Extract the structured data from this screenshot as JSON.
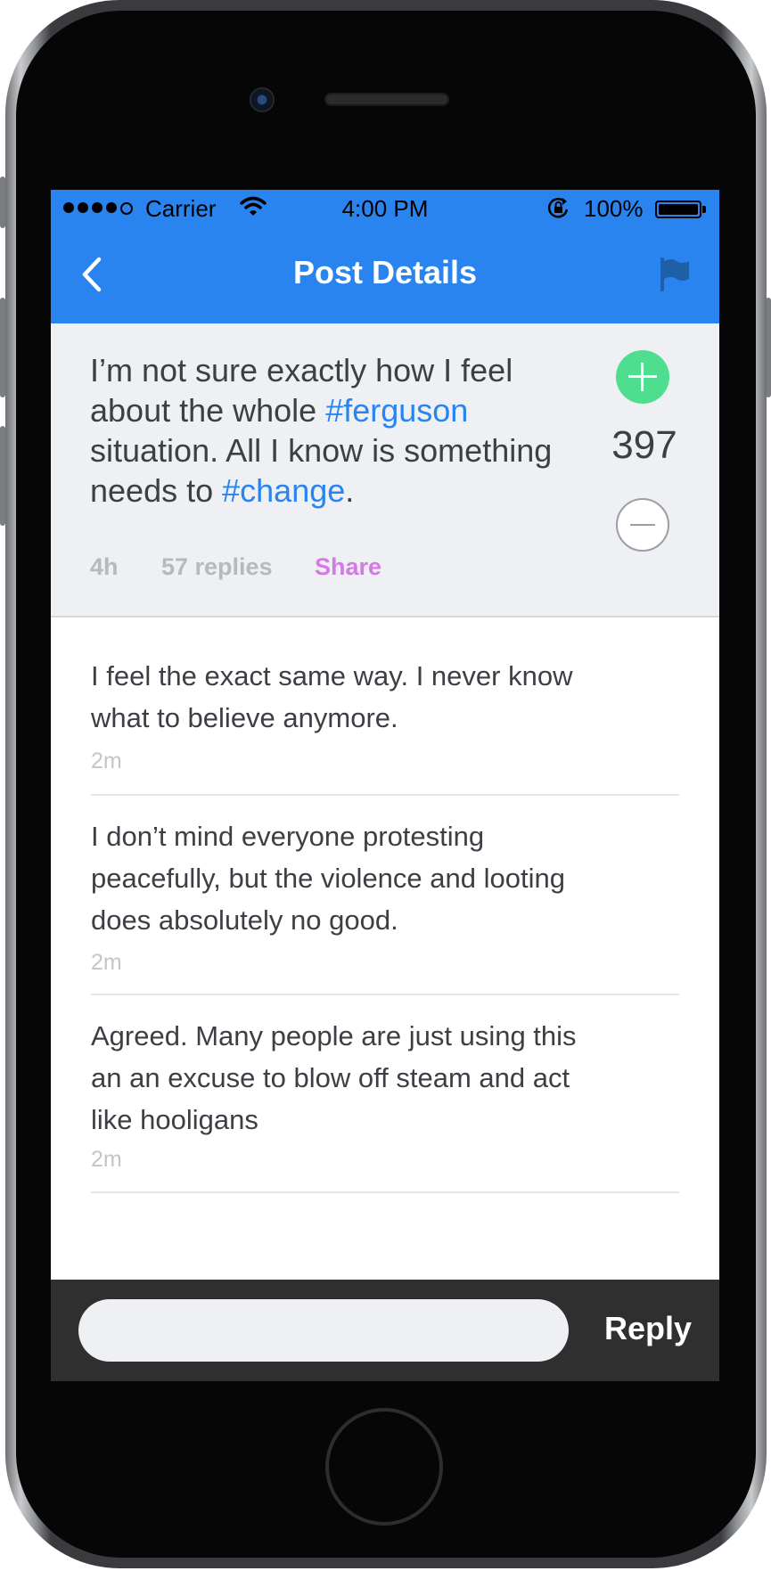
{
  "status_bar": {
    "carrier": "Carrier",
    "time": "4:00 PM",
    "battery_percent": "100%",
    "signal_bars_filled": 4,
    "signal_bars_total": 5,
    "icons": [
      "wifi-icon",
      "rotation-lock-icon",
      "battery-icon"
    ]
  },
  "nav": {
    "title": "Post Details",
    "back_icon": "chevron-left-icon",
    "report_icon": "flag-icon"
  },
  "post": {
    "text_1": "I’m not sure exactly how I feel about the whole ",
    "tag_1": "#ferguson",
    "text_2": " situation. All I know is something needs to ",
    "tag_2": "#change",
    "text_3": ".",
    "age": "4h",
    "replies": "57 replies",
    "share": "Share",
    "score": "397"
  },
  "replies": [
    {
      "text": "I feel the exact same way. I never know what to believe anymore.",
      "age": "2m"
    },
    {
      "text": "I don’t mind everyone protesting peacefully, but the violence and looting does absolutely no good.",
      "age": "2m"
    },
    {
      "text": "Agreed. Many people are just using this an an excuse to blow off steam and act like hooligans",
      "age": "2m"
    }
  ],
  "composer": {
    "placeholder": "",
    "reply_label": "Reply"
  },
  "colors": {
    "accent": "#2a84ef",
    "upvote": "#4fde8f",
    "share": "#d47ae6",
    "composer_bg": "#2f2f2f"
  }
}
